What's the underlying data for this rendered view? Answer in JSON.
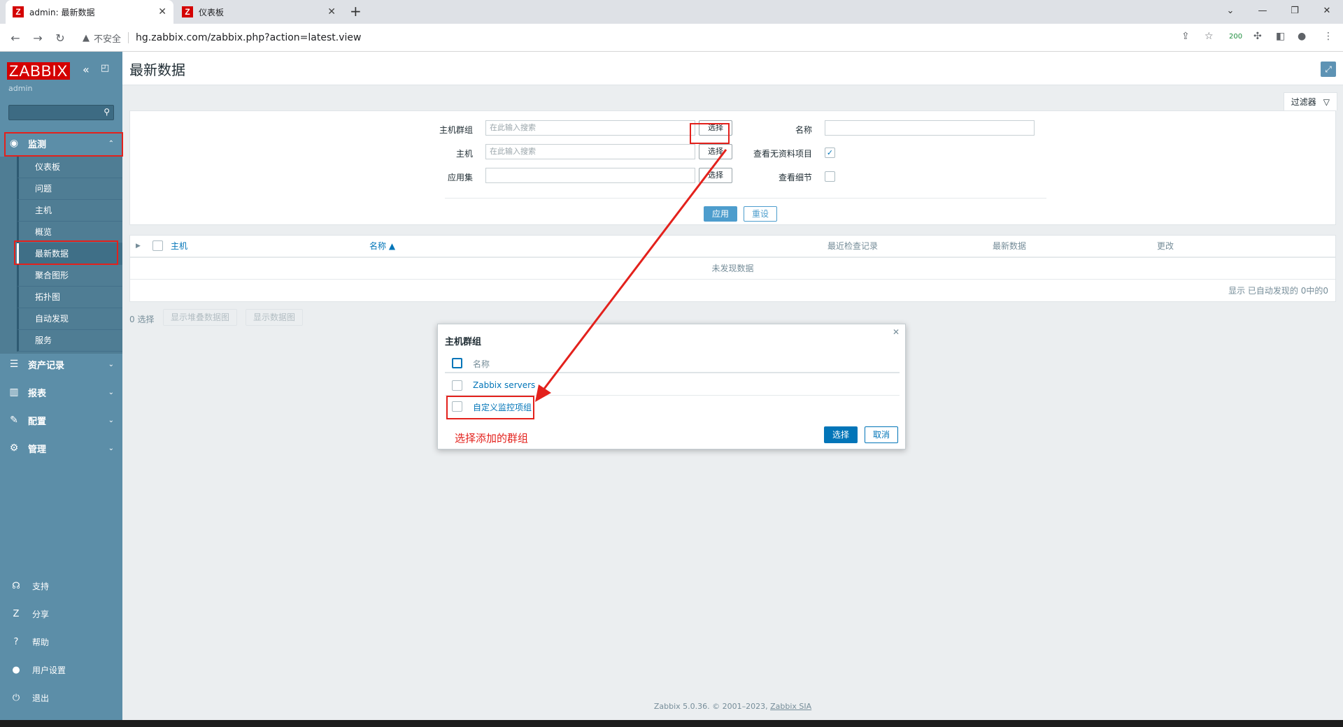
{
  "browser": {
    "tabs": [
      {
        "label": "admin: 最新数据",
        "icon": "zabbix-z-icon"
      },
      {
        "label": "仪表板",
        "icon": "zabbix-z-icon"
      }
    ],
    "insecure_label": "不安全",
    "url": "hg.zabbix.com/zabbix.php?action=latest.view",
    "extension_badge": "200"
  },
  "sidebar": {
    "logo": "ZABBIX",
    "user": "admin",
    "menu": [
      {
        "label": "监测",
        "icon": "eye-icon"
      },
      {
        "label": "资产记录",
        "icon": "list-icon"
      },
      {
        "label": "报表",
        "icon": "chart-icon"
      },
      {
        "label": "配置",
        "icon": "wrench-icon"
      },
      {
        "label": "管理",
        "icon": "gear-icon"
      }
    ],
    "monitoring_items": [
      "仪表板",
      "问题",
      "主机",
      "概览",
      "最新数据",
      "聚合图形",
      "拓扑图",
      "自动发现",
      "服务"
    ],
    "footer_items": [
      {
        "label": "支持",
        "icon": "headset-icon"
      },
      {
        "label": "分享",
        "icon": "zabbix-share-icon"
      },
      {
        "label": "帮助",
        "icon": "help-icon"
      },
      {
        "label": "用户设置",
        "icon": "user-icon"
      },
      {
        "label": "退出",
        "icon": "power-icon"
      }
    ]
  },
  "page": {
    "title": "最新数据",
    "filter_tab": "过滤器",
    "filter": {
      "host_group_label": "主机群组",
      "host_label": "主机",
      "app_label": "应用集",
      "name_label": "名称",
      "show_no_data_label": "查看无资料项目",
      "show_details_label": "查看细节",
      "search_placeholder": "在此输入搜索",
      "select_label": "选择",
      "apply_label": "应用",
      "reset_label": "重设"
    },
    "table": {
      "headers": [
        "主机",
        "名称 ▲",
        "最近检查记录",
        "最新数据",
        "更改"
      ],
      "no_data": "未发现数据",
      "stats": "显示 已自动发现的 0中的0"
    },
    "selected_count": "0 选择",
    "actions": [
      "显示堆叠数据图",
      "显示数据图"
    ],
    "footer_text": "Zabbix 5.0.36. © 2001–2023, ",
    "footer_link": "Zabbix SIA"
  },
  "dialog": {
    "title": "主机群组",
    "header": "名称",
    "rows": [
      "Zabbix servers",
      "自定义监控项组"
    ],
    "ok_label": "选择",
    "cancel_label": "取消"
  },
  "annotation": {
    "text": "选择添加的群组",
    "color": "#e3211c"
  }
}
